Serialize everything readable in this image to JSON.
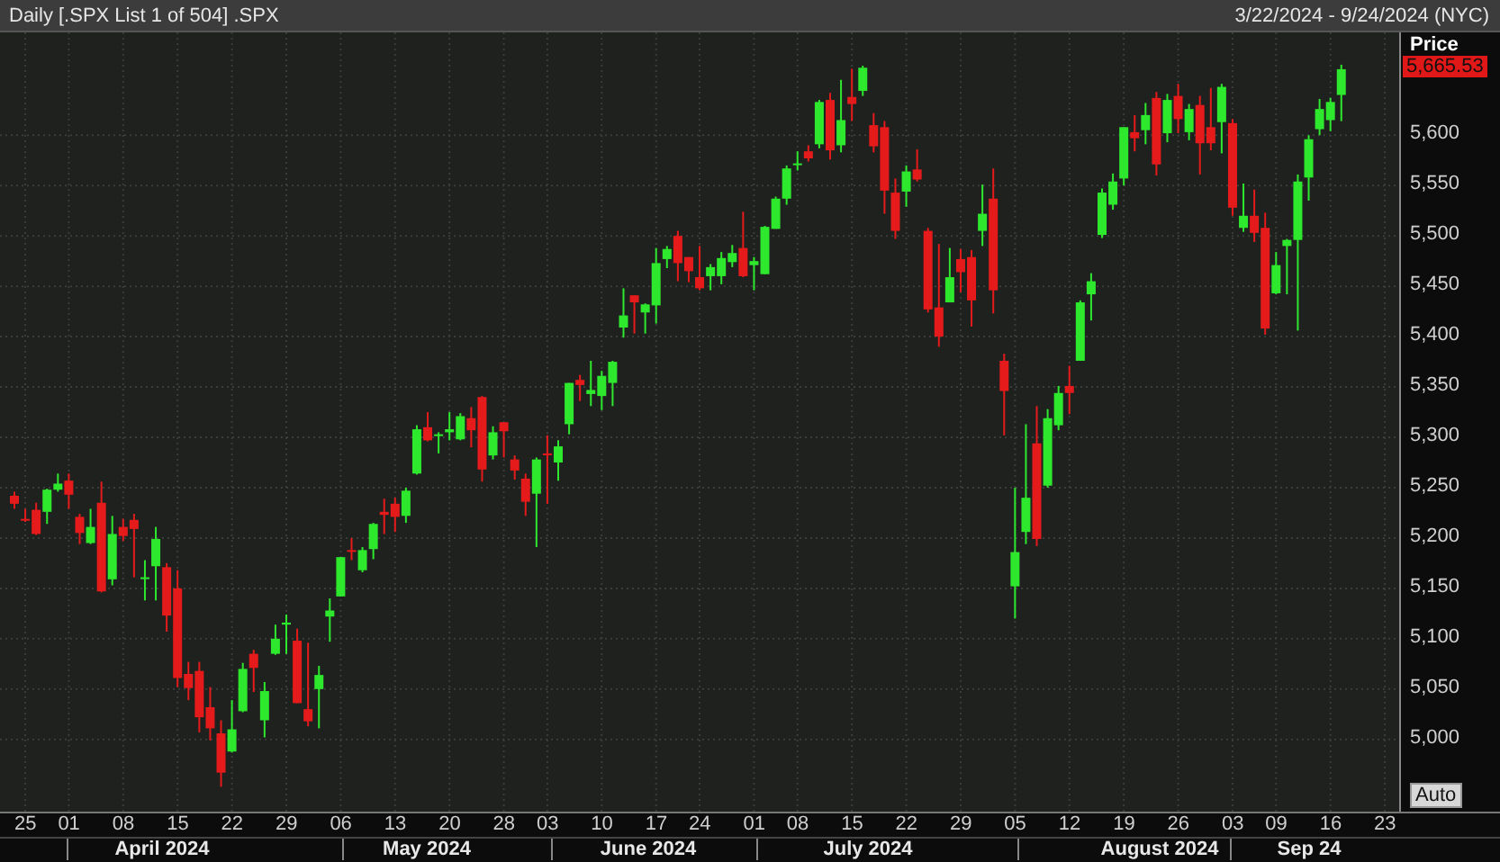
{
  "header": {
    "title": "Daily [.SPX List 1 of 504] .SPX",
    "date_range": "3/22/2024 - 9/24/2024 (NYC)"
  },
  "price_axis": {
    "title": "Price",
    "last_price": "5,665.53",
    "auto_button": "Auto"
  },
  "chart": {
    "chart_data": {
      "type": "candlestick",
      "grid": true,
      "categories": [
        null,
        "25",
        null,
        null,
        null,
        "01",
        null,
        null,
        null,
        null,
        "08",
        null,
        null,
        null,
        null,
        "15",
        null,
        null,
        null,
        null,
        "22",
        null,
        null,
        null,
        null,
        "29",
        null,
        null,
        null,
        null,
        "06",
        null,
        null,
        null,
        null,
        "13",
        null,
        null,
        null,
        null,
        "20",
        null,
        null,
        null,
        null,
        "28",
        null,
        null,
        null,
        "03",
        null,
        null,
        null,
        null,
        "10",
        null,
        null,
        null,
        null,
        "17",
        null,
        null,
        null,
        "24",
        null,
        null,
        null,
        null,
        "01",
        null,
        null,
        null,
        "08",
        null,
        null,
        null,
        null,
        "15",
        null,
        null,
        null,
        null,
        "22",
        null,
        null,
        null,
        null,
        "29",
        null,
        null,
        null,
        null,
        "05",
        null,
        null,
        null,
        null,
        "12",
        null,
        null,
        null,
        null,
        "19",
        null,
        null,
        null,
        null,
        "26",
        null,
        null,
        null,
        null,
        "03",
        null,
        null,
        null,
        "09",
        null,
        null,
        null,
        null,
        "16",
        null,
        null,
        null,
        null,
        "23"
      ],
      "ylim": [
        4928.3,
        5702.1
      ],
      "yticks": [
        {
          "value": 5600,
          "label": "5,600"
        },
        {
          "value": 5550,
          "label": "5,550"
        },
        {
          "value": 5500,
          "label": "5,500"
        },
        {
          "value": 5450,
          "label": "5,450"
        },
        {
          "value": 5400,
          "label": "5,400"
        },
        {
          "value": 5350,
          "label": "5,350"
        },
        {
          "value": 5300,
          "label": "5,300"
        },
        {
          "value": 5250,
          "label": "5,250"
        },
        {
          "value": 5200,
          "label": "5,200"
        },
        {
          "value": 5150,
          "label": "5,150"
        },
        {
          "value": 5100,
          "label": "5,100"
        },
        {
          "value": 5050,
          "label": "5,050"
        },
        {
          "value": 5000,
          "label": "5,000"
        }
      ],
      "ohlc": [
        [
          5242,
          5246,
          5229,
          5234
        ],
        [
          5219,
          5229,
          5216,
          5218
        ],
        [
          5228,
          5235,
          5203,
          5204
        ],
        [
          5226,
          5249,
          5214,
          5248
        ],
        [
          5248,
          5264,
          5246,
          5254
        ],
        [
          5257,
          5264,
          5229,
          5243
        ],
        [
          5221,
          5224,
          5194,
          5205
        ],
        [
          5195,
          5229,
          5194,
          5211
        ],
        [
          5235,
          5256,
          5146,
          5147
        ],
        [
          5159,
          5222,
          5153,
          5204
        ],
        [
          5211,
          5219,
          5197,
          5202
        ],
        [
          5218,
          5224,
          5161,
          5209
        ],
        [
          5160,
          5178,
          5138,
          5161
        ],
        [
          5172,
          5211,
          5138,
          5199
        ],
        [
          5171,
          5175,
          5107,
          5123
        ],
        [
          5150,
          5168,
          5052,
          5061
        ],
        [
          5065,
          5077,
          5039,
          5051
        ],
        [
          5068,
          5077,
          5007,
          5022
        ],
        [
          5032,
          5052,
          4999,
          5011
        ],
        [
          5006,
          5019,
          4953,
          4967
        ],
        [
          4988,
          5039,
          4987,
          5010
        ],
        [
          5028,
          5076,
          5027,
          5070
        ],
        [
          5085,
          5089,
          5047,
          5071
        ],
        [
          5019,
          5057,
          5002,
          5048
        ],
        [
          5085,
          5114,
          5084,
          5100
        ],
        [
          5114,
          5124,
          5085,
          5116
        ],
        [
          5098,
          5110,
          5036,
          5036
        ],
        [
          5030,
          5096,
          5013,
          5018
        ],
        [
          5050,
          5073,
          5011,
          5064
        ],
        [
          5122,
          5140,
          5097,
          5128
        ],
        [
          5142,
          5181,
          5142,
          5181
        ],
        [
          5188,
          5200,
          5178,
          5187
        ],
        [
          5168,
          5191,
          5166,
          5188
        ],
        [
          5189,
          5215,
          5179,
          5214
        ],
        [
          5226,
          5239,
          5204,
          5223
        ],
        [
          5234,
          5240,
          5206,
          5221
        ],
        [
          5222,
          5250,
          5215,
          5247
        ],
        [
          5264,
          5312,
          5263,
          5308
        ],
        [
          5310,
          5325,
          5296,
          5297
        ],
        [
          5303,
          5305,
          5284,
          5303
        ],
        [
          5305,
          5325,
          5297,
          5308
        ],
        [
          5298,
          5324,
          5297,
          5321
        ],
        [
          5319,
          5330,
          5290,
          5307
        ],
        [
          5340,
          5341,
          5256,
          5268
        ],
        [
          5282,
          5311,
          5278,
          5305
        ],
        [
          5315,
          5315,
          5280,
          5306
        ],
        [
          5278,
          5282,
          5258,
          5267
        ],
        [
          5259,
          5264,
          5222,
          5236
        ],
        [
          5244,
          5280,
          5191,
          5278
        ],
        [
          5284,
          5302,
          5234,
          5283
        ],
        [
          5275,
          5297,
          5257,
          5291
        ],
        [
          5313,
          5354,
          5303,
          5354
        ],
        [
          5357,
          5362,
          5336,
          5352
        ],
        [
          5343,
          5376,
          5331,
          5347
        ],
        [
          5341,
          5366,
          5327,
          5361
        ],
        [
          5354,
          5376,
          5331,
          5375
        ],
        [
          5409,
          5448,
          5399,
          5421
        ],
        [
          5441,
          5441,
          5403,
          5434
        ],
        [
          5424,
          5433,
          5403,
          5432
        ],
        [
          5431,
          5488,
          5413,
          5473
        ],
        [
          5477,
          5490,
          5468,
          5487
        ],
        [
          5500,
          5505,
          5455,
          5473
        ],
        [
          5479,
          5479,
          5454,
          5465
        ],
        [
          5459,
          5490,
          5446,
          5448
        ],
        [
          5460,
          5472,
          5446,
          5469
        ],
        [
          5460,
          5484,
          5452,
          5478
        ],
        [
          5474,
          5491,
          5469,
          5483
        ],
        [
          5488,
          5524,
          5459,
          5460
        ],
        [
          5471,
          5479,
          5446,
          5475
        ],
        [
          5462,
          5510,
          5462,
          5509
        ],
        [
          5507,
          5539,
          5507,
          5537
        ],
        [
          5537,
          5570,
          5531,
          5567
        ],
        [
          5572,
          5584,
          5565,
          5572
        ],
        [
          5584,
          5590,
          5574,
          5577
        ],
        [
          5591,
          5635,
          5587,
          5633
        ],
        [
          5635,
          5642,
          5576,
          5585
        ],
        [
          5590,
          5655,
          5583,
          5615
        ],
        [
          5638,
          5666,
          5614,
          5631
        ],
        [
          5644,
          5669,
          5639,
          5667
        ],
        [
          5610,
          5622,
          5583,
          5589
        ],
        [
          5608,
          5614,
          5522,
          5545
        ],
        [
          5543,
          5557,
          5497,
          5505
        ],
        [
          5544,
          5570,
          5529,
          5564
        ],
        [
          5566,
          5586,
          5554,
          5556
        ],
        [
          5505,
          5508,
          5424,
          5427
        ],
        [
          5429,
          5492,
          5390,
          5400
        ],
        [
          5434,
          5488,
          5434,
          5459
        ],
        [
          5477,
          5487,
          5444,
          5464
        ],
        [
          5479,
          5486,
          5410,
          5436
        ],
        [
          5505,
          5551,
          5490,
          5522
        ],
        [
          5537,
          5567,
          5423,
          5446
        ],
        [
          5376,
          5383,
          5302,
          5346
        ],
        [
          5152,
          5250,
          5120,
          5186
        ],
        [
          5206,
          5313,
          5194,
          5240
        ],
        [
          5294,
          5331,
          5192,
          5199
        ],
        [
          5252,
          5328,
          5250,
          5319
        ],
        [
          5312,
          5351,
          5307,
          5344
        ],
        [
          5351,
          5371,
          5323,
          5344
        ],
        [
          5376,
          5436,
          5376,
          5434
        ],
        [
          5442,
          5463,
          5416,
          5455
        ],
        [
          5501,
          5547,
          5498,
          5543
        ],
        [
          5531,
          5562,
          5526,
          5554
        ],
        [
          5557,
          5608,
          5550,
          5608
        ],
        [
          5603,
          5620,
          5584,
          5597
        ],
        [
          5605,
          5632,
          5591,
          5620
        ],
        [
          5637,
          5643,
          5560,
          5571
        ],
        [
          5602,
          5641,
          5593,
          5635
        ],
        [
          5639,
          5651,
          5602,
          5616
        ],
        [
          5603,
          5631,
          5595,
          5626
        ],
        [
          5630,
          5639,
          5561,
          5592
        ],
        [
          5608,
          5647,
          5585,
          5592
        ],
        [
          5613,
          5651,
          5582,
          5648
        ],
        [
          5612,
          5616,
          5520,
          5528
        ],
        [
          5508,
          5552,
          5504,
          5520
        ],
        [
          5520,
          5546,
          5494,
          5503
        ],
        [
          5508,
          5523,
          5402,
          5408
        ],
        [
          5443,
          5484,
          5442,
          5471
        ],
        [
          5490,
          5497,
          5442,
          5496
        ],
        [
          5496,
          5561,
          5406,
          5554
        ],
        [
          5558,
          5600,
          5535,
          5596
        ],
        [
          5606,
          5636,
          5600,
          5626
        ],
        [
          5615,
          5637,
          5604,
          5633
        ],
        [
          5640,
          5670,
          5614,
          5665.53
        ],
        null,
        null,
        null,
        null
      ]
    }
  },
  "time_axis": {
    "months": [
      "April 2024",
      "May 2024",
      "June 2024",
      "July 2024",
      "August 2024",
      "Sep 24"
    ]
  }
}
